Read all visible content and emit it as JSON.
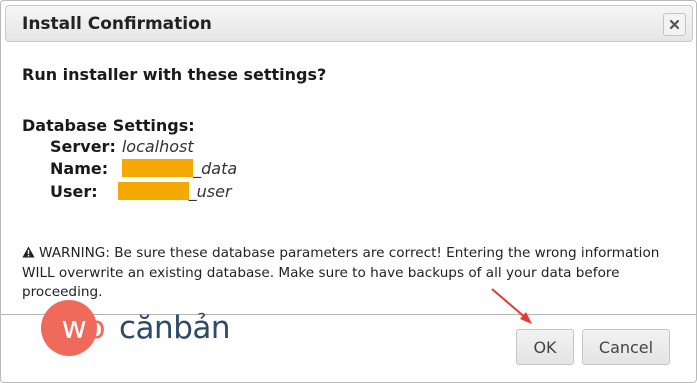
{
  "dialog": {
    "title": "Install Confirmation",
    "close_symbol": "×"
  },
  "content": {
    "question": "Run installer with these settings?",
    "db_heading": "Database Settings:",
    "server_label": "Server:",
    "server_value": "localhost",
    "name_label": "Name:",
    "name_suffix": "_data",
    "user_label": "User:",
    "user_suffix": "_user",
    "redaction_color": "#f5a800",
    "warning_text": "WARNING: Be sure these database parameters are correct! Entering the wrong information WILL overwrite an existing database. Make sure to have backups of all your data before proceeding."
  },
  "buttons": {
    "ok_label": "OK",
    "cancel_label": "Cancel"
  },
  "watermark": {
    "brand": "wpcănbản",
    "brand_color": "#f06a5c",
    "text_color": "#2e4a6a"
  },
  "annotation": {
    "arrow_color": "#e53935",
    "points_to": "ok-button"
  }
}
